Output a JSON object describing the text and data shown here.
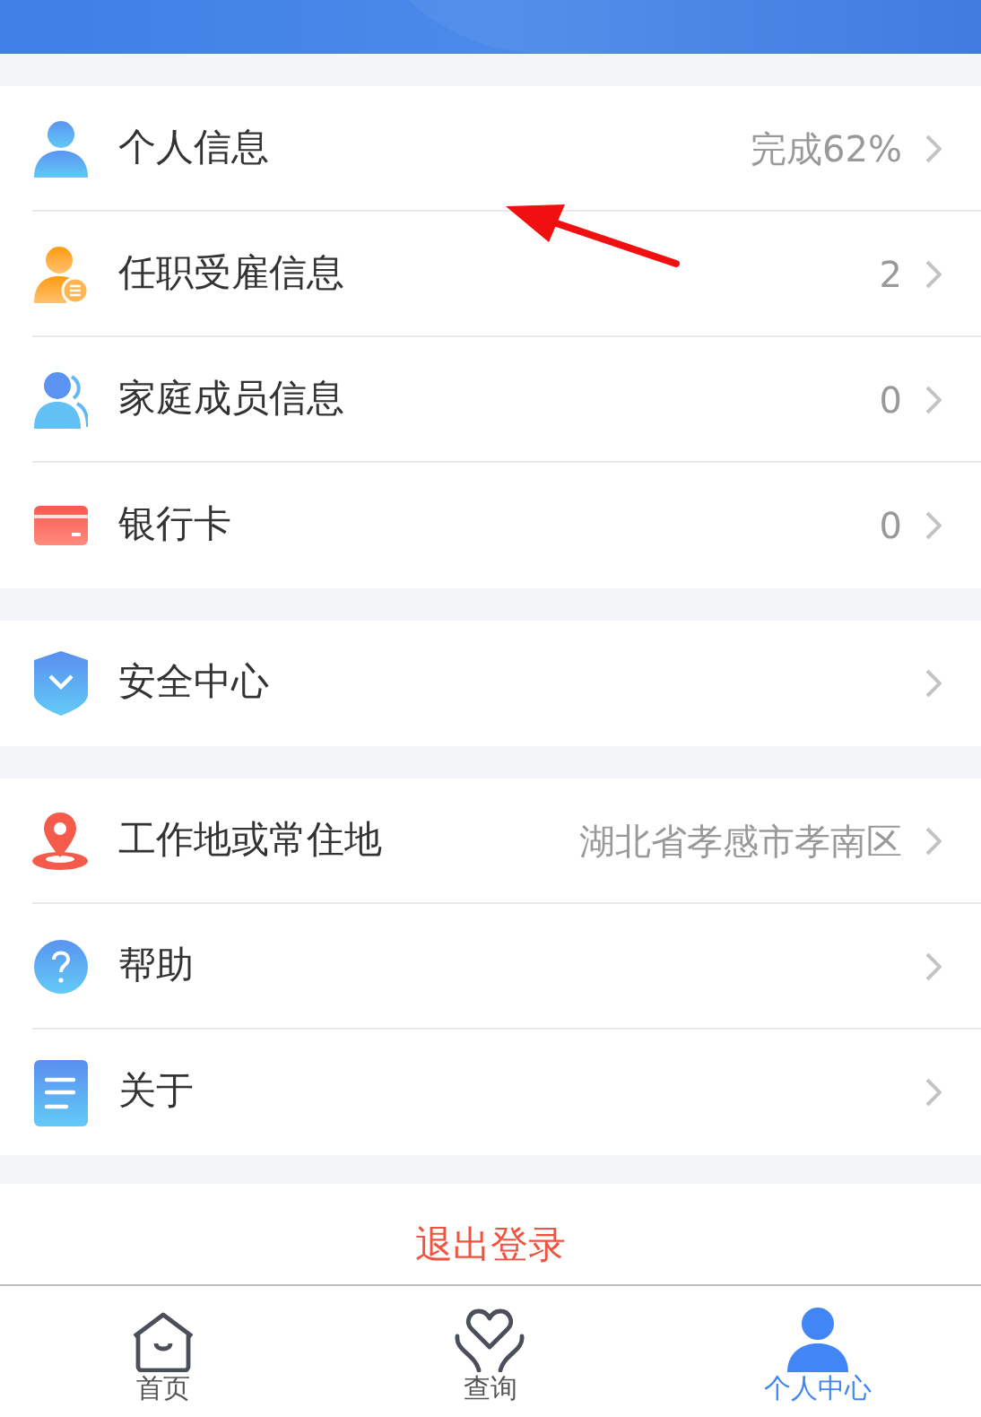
{
  "groups": [
    {
      "items": [
        {
          "label": "个人信息",
          "value": "完成62%"
        },
        {
          "label": "任职受雇信息",
          "value": "2"
        },
        {
          "label": "家庭成员信息",
          "value": "0"
        },
        {
          "label": "银行卡",
          "value": "0"
        }
      ]
    },
    {
      "items": [
        {
          "label": "安全中心"
        }
      ]
    },
    {
      "items": [
        {
          "label": "工作地或常住地",
          "value": "湖北省孝感市孝南区"
        },
        {
          "label": "帮助"
        },
        {
          "label": "关于"
        }
      ]
    }
  ],
  "logout": "退出登录",
  "tabs": [
    {
      "label": "首页",
      "selected": false
    },
    {
      "label": "查询",
      "selected": false
    },
    {
      "label": "个人中心",
      "selected": true
    }
  ]
}
